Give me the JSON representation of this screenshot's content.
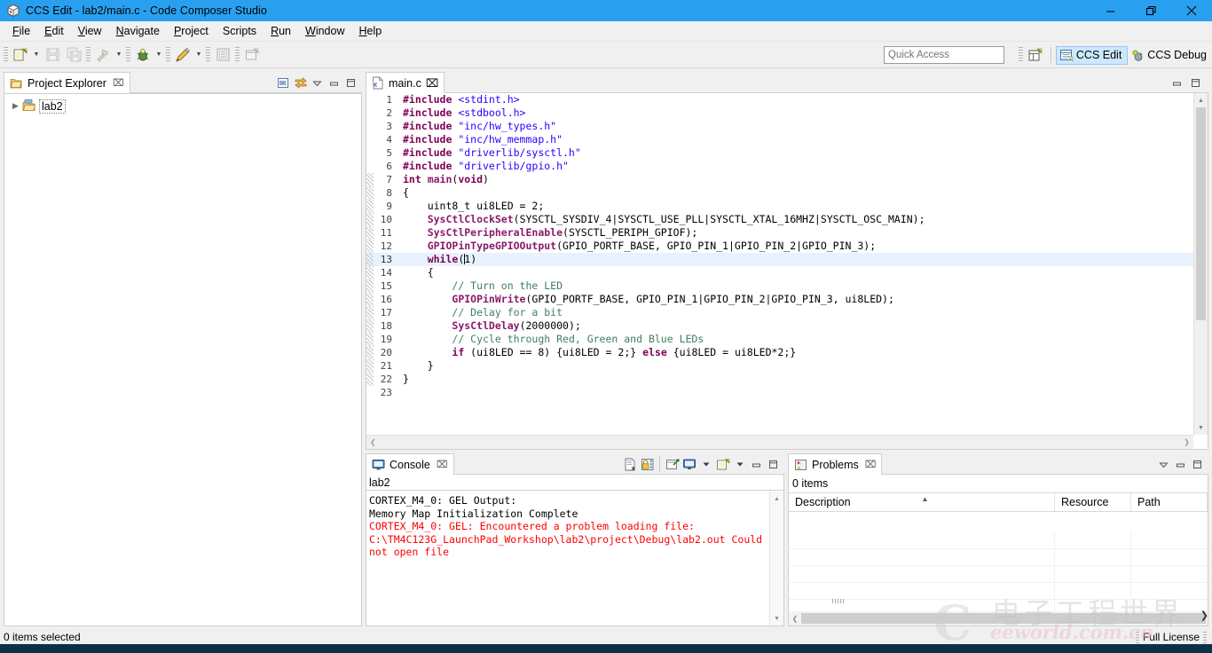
{
  "window": {
    "title": "CCS Edit - lab2/main.c - Code Composer Studio",
    "app_icon": "ccs-cube-icon",
    "minimize": "—",
    "maximize": "❐",
    "close": "✕",
    "titlebar_color": "#29a0ef"
  },
  "menubar": {
    "items": [
      {
        "label": "File",
        "mnemonic": "F"
      },
      {
        "label": "Edit",
        "mnemonic": "E"
      },
      {
        "label": "View",
        "mnemonic": "V"
      },
      {
        "label": "Navigate",
        "mnemonic": "N"
      },
      {
        "label": "Project",
        "mnemonic": "P"
      },
      {
        "label": "Scripts",
        "mnemonic": ""
      },
      {
        "label": "Run",
        "mnemonic": "R"
      },
      {
        "label": "Window",
        "mnemonic": "W"
      },
      {
        "label": "Help",
        "mnemonic": "H"
      }
    ]
  },
  "toolbar": {
    "buttons": [
      {
        "name": "new-icon",
        "enabled": true
      },
      {
        "name": "save-icon",
        "enabled": false
      },
      {
        "name": "save-all-icon",
        "enabled": false
      },
      {
        "name": "build-hammer-icon",
        "enabled": false
      },
      {
        "name": "debug-bug-icon",
        "enabled": true
      },
      {
        "name": "marker-pen-icon",
        "enabled": true
      },
      {
        "name": "toggle-block-selection-icon",
        "enabled": false
      },
      {
        "name": "external-tools-icon",
        "enabled": false
      }
    ],
    "quick_access": {
      "placeholder": "Quick Access",
      "value": ""
    },
    "open_perspective_icon": "open-perspective-icon",
    "perspectives": [
      {
        "label": "CCS Edit",
        "icon": "ccs-edit-icon",
        "active": true
      },
      {
        "label": "CCS Debug",
        "icon": "ccs-debug-icon",
        "active": false
      }
    ]
  },
  "project_explorer": {
    "tab_label": "Project Explorer",
    "tab_icon": "project-explorer-icon",
    "close_icon": "⌧",
    "view_buttons": [
      {
        "name": "collapse-all-icon"
      },
      {
        "name": "link-with-editor-icon"
      },
      {
        "name": "view-menu-icon"
      },
      {
        "name": "minimize-icon"
      },
      {
        "name": "maximize-icon"
      }
    ],
    "tree": [
      {
        "label": "lab2",
        "icon": "ccs-project-icon",
        "expanded": false,
        "selected": true
      }
    ]
  },
  "editor": {
    "tab_label": "main.c",
    "tab_icon": "c-file-icon",
    "close_icon": "⌧",
    "view_buttons": [
      {
        "name": "minimize-icon"
      },
      {
        "name": "maximize-icon"
      }
    ],
    "current_line": 13,
    "caret_line": 13,
    "lines": [
      {
        "n": 1,
        "tokens": [
          {
            "t": "#include ",
            "c": "pp"
          },
          {
            "t": "<stdint.h>",
            "c": "str"
          }
        ]
      },
      {
        "n": 2,
        "tokens": [
          {
            "t": "#include ",
            "c": "pp"
          },
          {
            "t": "<stdbool.h>",
            "c": "str"
          }
        ]
      },
      {
        "n": 3,
        "tokens": [
          {
            "t": "#include ",
            "c": "pp"
          },
          {
            "t": "\"inc/hw_types.h\"",
            "c": "str"
          }
        ]
      },
      {
        "n": 4,
        "tokens": [
          {
            "t": "#include ",
            "c": "pp"
          },
          {
            "t": "\"inc/hw_memmap.h\"",
            "c": "str"
          }
        ]
      },
      {
        "n": 5,
        "tokens": [
          {
            "t": "#include ",
            "c": "pp"
          },
          {
            "t": "\"driverlib/sysctl.h\"",
            "c": "str"
          }
        ]
      },
      {
        "n": 6,
        "tokens": [
          {
            "t": "#include ",
            "c": "pp"
          },
          {
            "t": "\"driverlib/gpio.h\"",
            "c": "str"
          }
        ]
      },
      {
        "n": 7,
        "tokens": [
          {
            "t": "int ",
            "c": "kw"
          },
          {
            "t": "main",
            "c": "fn"
          },
          {
            "t": "(",
            "c": "plain"
          },
          {
            "t": "void",
            "c": "kw"
          },
          {
            "t": ")",
            "c": "plain"
          }
        ],
        "bracket": true
      },
      {
        "n": 8,
        "tokens": [
          {
            "t": "{",
            "c": "plain"
          }
        ],
        "bracket": true
      },
      {
        "n": 9,
        "tokens": [
          {
            "t": "    uint8_t ui8LED = ",
            "c": "plain"
          },
          {
            "t": "2",
            "c": "num"
          },
          {
            "t": ";",
            "c": "plain"
          }
        ],
        "bracket": true
      },
      {
        "n": 10,
        "tokens": [
          {
            "t": "    ",
            "c": "plain"
          },
          {
            "t": "SysCtlClockSet",
            "c": "fn"
          },
          {
            "t": "(SYSCTL_SYSDIV_4|SYSCTL_USE_PLL|SYSCTL_XTAL_16MHZ|SYSCTL_OSC_MAIN);",
            "c": "plain"
          }
        ],
        "bracket": true
      },
      {
        "n": 11,
        "tokens": [
          {
            "t": "    ",
            "c": "plain"
          },
          {
            "t": "SysCtlPeripheralEnable",
            "c": "fn"
          },
          {
            "t": "(SYSCTL_PERIPH_GPIOF);",
            "c": "plain"
          }
        ],
        "bracket": true
      },
      {
        "n": 12,
        "tokens": [
          {
            "t": "    ",
            "c": "plain"
          },
          {
            "t": "GPIOPinTypeGPIOOutput",
            "c": "fn"
          },
          {
            "t": "(GPIO_PORTF_BASE, GPIO_PIN_1|GPIO_PIN_2|GPIO_PIN_3);",
            "c": "plain"
          }
        ],
        "bracket": true
      },
      {
        "n": 13,
        "tokens": [
          {
            "t": "    ",
            "c": "plain"
          },
          {
            "t": "while",
            "c": "kw"
          },
          {
            "t": "(",
            "c": "plain"
          },
          {
            "t": "CARET",
            "c": "caret"
          },
          {
            "t": "1",
            "c": "num"
          },
          {
            "t": ")",
            "c": "plain"
          }
        ],
        "bracket": true,
        "current": true
      },
      {
        "n": 14,
        "tokens": [
          {
            "t": "    {",
            "c": "plain"
          }
        ],
        "bracket": true
      },
      {
        "n": 15,
        "tokens": [
          {
            "t": "        ",
            "c": "plain"
          },
          {
            "t": "// Turn on the LED",
            "c": "cmt"
          }
        ],
        "bracket": true
      },
      {
        "n": 16,
        "tokens": [
          {
            "t": "        ",
            "c": "plain"
          },
          {
            "t": "GPIOPinWrite",
            "c": "fn"
          },
          {
            "t": "(GPIO_PORTF_BASE, GPIO_PIN_1|GPIO_PIN_2|GPIO_PIN_3, ui8LED);",
            "c": "plain"
          }
        ],
        "bracket": true
      },
      {
        "n": 17,
        "tokens": [
          {
            "t": "        ",
            "c": "plain"
          },
          {
            "t": "// Delay for a bit",
            "c": "cmt"
          }
        ],
        "bracket": true
      },
      {
        "n": 18,
        "tokens": [
          {
            "t": "        ",
            "c": "plain"
          },
          {
            "t": "SysCtlDelay",
            "c": "fn"
          },
          {
            "t": "(",
            "c": "plain"
          },
          {
            "t": "2000000",
            "c": "num"
          },
          {
            "t": ");",
            "c": "plain"
          }
        ],
        "bracket": true
      },
      {
        "n": 19,
        "tokens": [
          {
            "t": "        ",
            "c": "plain"
          },
          {
            "t": "// Cycle through Red, Green and Blue LEDs",
            "c": "cmt"
          }
        ],
        "bracket": true
      },
      {
        "n": 20,
        "tokens": [
          {
            "t": "        ",
            "c": "plain"
          },
          {
            "t": "if",
            "c": "kw"
          },
          {
            "t": " (ui8LED == ",
            "c": "plain"
          },
          {
            "t": "8",
            "c": "num"
          },
          {
            "t": ") {ui8LED = ",
            "c": "plain"
          },
          {
            "t": "2",
            "c": "num"
          },
          {
            "t": ";} ",
            "c": "plain"
          },
          {
            "t": "else",
            "c": "kw"
          },
          {
            "t": " {ui8LED = ui8LED*",
            "c": "plain"
          },
          {
            "t": "2",
            "c": "num"
          },
          {
            "t": ";}",
            "c": "plain"
          }
        ],
        "bracket": true
      },
      {
        "n": 21,
        "tokens": [
          {
            "t": "    }",
            "c": "plain"
          }
        ],
        "bracket": true
      },
      {
        "n": 22,
        "tokens": [
          {
            "t": "}",
            "c": "plain"
          }
        ],
        "bracket": true
      },
      {
        "n": 23,
        "tokens": [
          {
            "t": "",
            "c": "plain"
          }
        ]
      }
    ]
  },
  "console": {
    "tab_label": "Console",
    "tab_icon": "console-icon",
    "close_icon": "⌧",
    "toolbar_buttons": [
      {
        "name": "clear-console-icon"
      },
      {
        "name": "lock-scroll-icon"
      },
      {
        "name": "pin-console-icon"
      },
      {
        "name": "display-selected-console-icon"
      },
      {
        "name": "display-selected-console-dropdown-icon"
      },
      {
        "name": "open-console-icon"
      },
      {
        "name": "open-console-dropdown-icon"
      },
      {
        "name": "minimize-icon"
      },
      {
        "name": "maximize-icon"
      }
    ],
    "header": "lab2",
    "output": [
      {
        "text": "CORTEX_M4_0: GEL Output: ",
        "color": "black"
      },
      {
        "text": "Memory Map Initialization Complete",
        "color": "black"
      },
      {
        "text": "CORTEX_M4_0: GEL: Encountered a problem loading file:",
        "color": "red"
      },
      {
        "text": "C:\\TM4C123G_LaunchPad_Workshop\\lab2\\project\\Debug\\lab2.out Could",
        "color": "red"
      },
      {
        "text": "not open file",
        "color": "red"
      }
    ]
  },
  "problems": {
    "tab_label": "Problems",
    "tab_icon": "problems-icon",
    "close_icon": "⌧",
    "view_buttons": [
      {
        "name": "view-menu-icon"
      },
      {
        "name": "minimize-icon"
      },
      {
        "name": "maximize-icon"
      }
    ],
    "item_count": "0 items",
    "columns": [
      {
        "label": "Description",
        "sorted": true
      },
      {
        "label": "Resource",
        "sorted": false
      },
      {
        "label": "Path",
        "sorted": false
      }
    ],
    "rows": []
  },
  "statusbar": {
    "left_text": "0 items selected",
    "right_text": "Full License"
  },
  "watermark": {
    "brand_cn": "电子工程世界",
    "brand_en": "eeworld.com.cn",
    "logo_letter": "C"
  }
}
